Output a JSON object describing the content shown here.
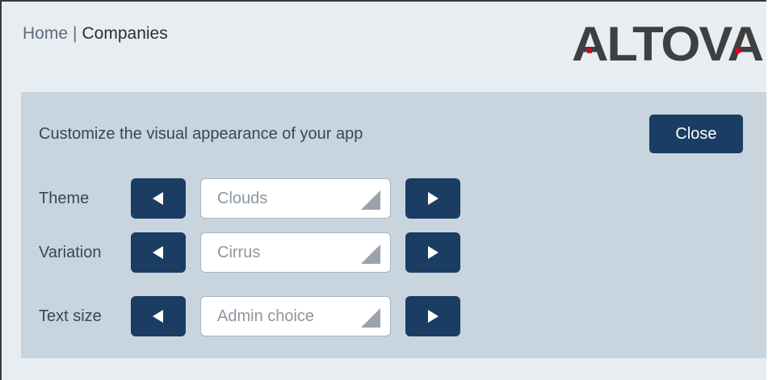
{
  "breadcrumb": {
    "home": "Home",
    "separator": "|",
    "current": "Companies"
  },
  "logo": {
    "text": "ALTOVA",
    "icon": "altova-logo"
  },
  "panel": {
    "intro": "Customize the visual appearance of your app",
    "close_label": "Close",
    "settings": [
      {
        "label": "Theme",
        "value": "Clouds"
      },
      {
        "label": "Variation",
        "value": "Cirrus"
      },
      {
        "label": "Text size",
        "value": "Admin choice"
      }
    ]
  },
  "icons": {
    "prev": "triangle-left-icon",
    "next": "triangle-right-icon",
    "select": "dropdown-corner-icon"
  },
  "colors": {
    "accent": "#1b3d63",
    "panel_bg": "#c8d5df",
    "page_bg": "#e8edf1",
    "logo_dot": "#e2001a"
  }
}
